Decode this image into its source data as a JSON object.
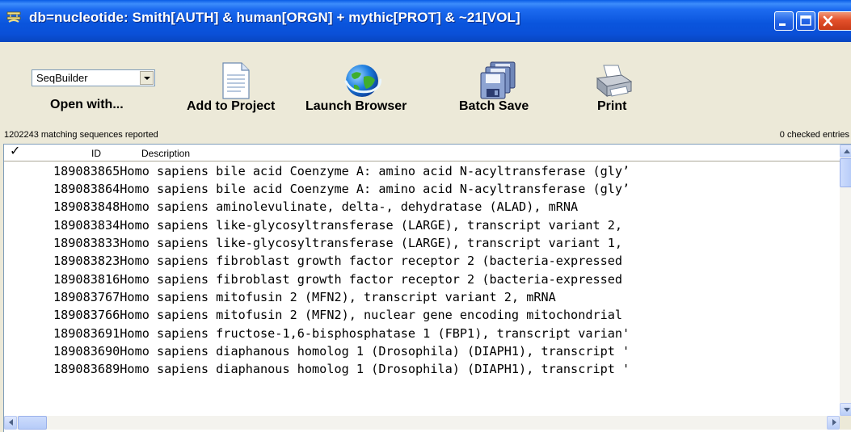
{
  "window": {
    "title": "db=nucleotide: Smith[AUTH] & human[ORGN] + mythic[PROT] & ~21[VOL]"
  },
  "toolbar": {
    "open_with_select": "SeqBuilder",
    "open_with_label": "Open with...",
    "add_to_project_label": "Add to Project",
    "launch_browser_label": "Launch Browser",
    "batch_save_label": "Batch Save",
    "print_label": "Print"
  },
  "status": {
    "matching": "1202243 matching sequences reported",
    "checked": "0 checked entries"
  },
  "list": {
    "columns": {
      "check": "✓",
      "id": "ID",
      "description": "Description"
    },
    "rows": [
      "189083865Homo sapiens bile acid Coenzyme A: amino acid N-acyltransferase (gly’",
      "189083864Homo sapiens bile acid Coenzyme A: amino acid N-acyltransferase (gly’",
      "189083848Homo sapiens aminolevulinate, delta-, dehydratase (ALAD), mRNA",
      "189083834Homo sapiens like-glycosyltransferase (LARGE), transcript variant 2,",
      "189083833Homo sapiens like-glycosyltransferase (LARGE), transcript variant 1,",
      "189083823Homo sapiens fibroblast growth factor receptor 2 (bacteria-expressed",
      "189083816Homo sapiens fibroblast growth factor receptor 2 (bacteria-expressed",
      "189083767Homo sapiens mitofusin 2 (MFN2), transcript variant 2, mRNA",
      "189083766Homo sapiens mitofusin 2 (MFN2), nuclear gene encoding mitochondrial",
      "189083691Homo sapiens fructose-1,6-bisphosphatase 1 (FBP1), transcript varian'",
      "189083690Homo sapiens diaphanous homolog 1 (Drosophila) (DIAPH1), transcript '",
      "189083689Homo sapiens diaphanous homolog 1 (Drosophila) (DIAPH1), transcript '"
    ]
  },
  "icons": {
    "app": "dna-app-icon",
    "add_to_project": "document-icon",
    "launch_browser": "globe-icon",
    "batch_save": "floppy-disks-icon",
    "print": "printer-icon"
  }
}
